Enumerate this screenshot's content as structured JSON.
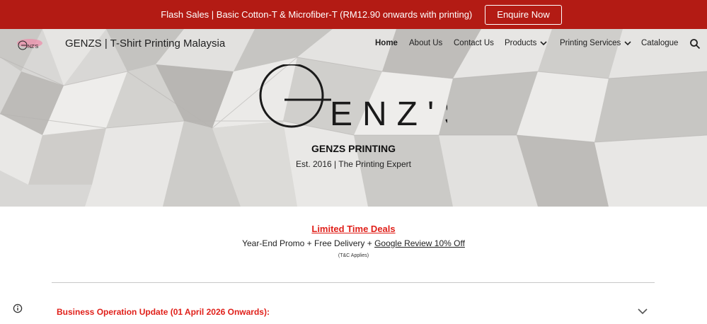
{
  "promo_bar": {
    "text": "Flash Sales | Basic Cotton-T & Microfiber-T (RM12.90 onwards with printing)",
    "button_label": "Enquire Now",
    "background_color": "#b31b14"
  },
  "header": {
    "logo_text": "GENZ'S",
    "site_title": "GENZS | T-Shirt Printing Malaysia",
    "nav": [
      {
        "label": "Home",
        "active": true
      },
      {
        "label": "About Us"
      },
      {
        "label": "Contact Us"
      },
      {
        "label": "Products",
        "has_dropdown": true
      },
      {
        "label": "Printing Services",
        "has_dropdown": true
      },
      {
        "label": "Catalogue"
      }
    ],
    "search_icon": "search-icon"
  },
  "hero": {
    "logo_text": "ENZ'S",
    "title": "GENZS PRINTING",
    "subtitle": "Est. 2016  |  The Printing Expert"
  },
  "deals": {
    "title": "Limited Time Deals",
    "line_prefix": "Year-End Promo + Free Delivery + ",
    "link_text": "Google Review 10% Off",
    "terms": "(T&C Applies)",
    "accent_color": "#e0201a"
  },
  "accordion": {
    "title": "Business Operation Update (01 April 2026 Onwards):",
    "icon": "chevron-down-icon"
  }
}
